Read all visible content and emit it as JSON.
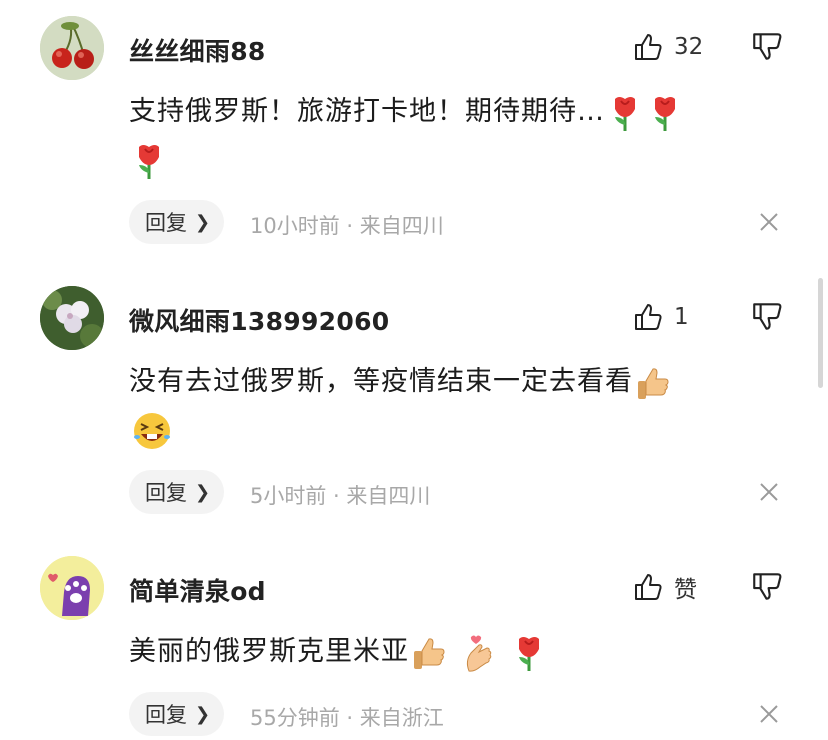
{
  "comments": [
    {
      "username": "丝丝细雨88",
      "likes": "32",
      "text": "支持俄罗斯！旅游打卡地！期待期待…",
      "emojis": [
        "rose",
        "rose",
        "rose"
      ],
      "reply_label": "回复",
      "meta": "10小时前 · 来自四川"
    },
    {
      "username": "微风细雨138992060",
      "likes": "1",
      "text": "没有去过俄罗斯，等疫情结束一定去看看",
      "emojis": [
        "thumbs-up",
        "grinning-squint"
      ],
      "reply_label": "回复",
      "meta": "5小时前 · 来自四川"
    },
    {
      "username": "简单清泉od",
      "likes": "赞",
      "text": "美丽的俄罗斯克里米亚",
      "emojis": [
        "thumbs-up",
        "finger-heart",
        "rose"
      ],
      "reply_label": "回复",
      "meta": "55分钟前 · 来自浙江"
    }
  ]
}
